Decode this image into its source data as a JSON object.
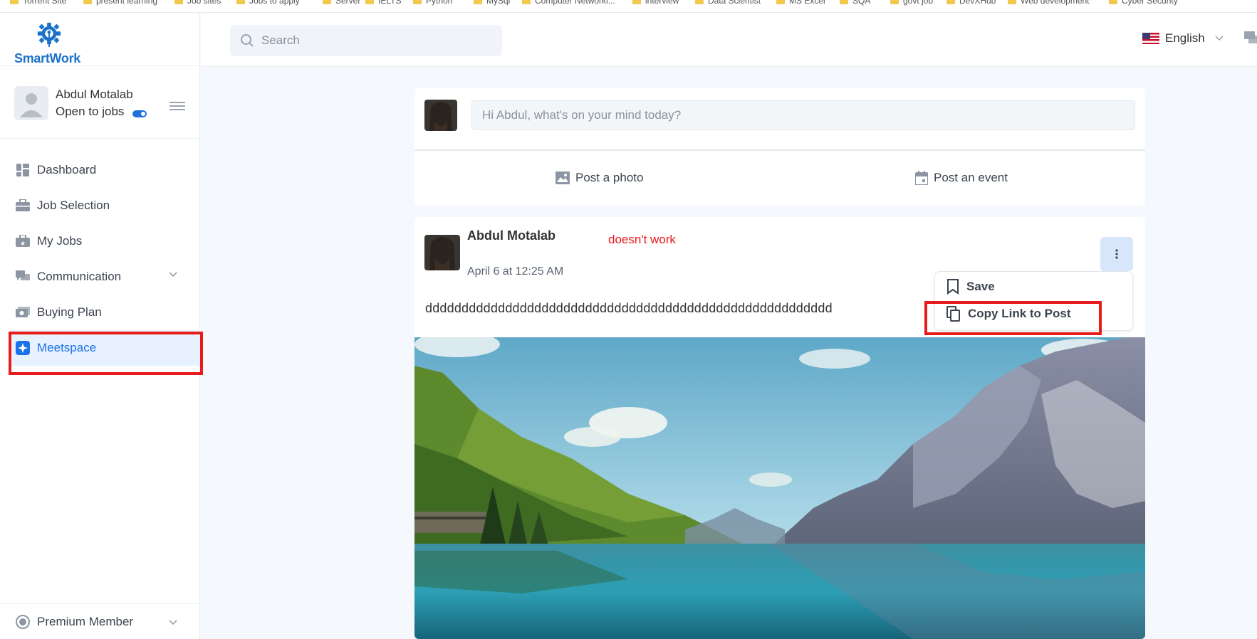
{
  "bookmarks": [
    "Torrent Site",
    "present learning",
    "Job sites",
    "Jobs to apply",
    "Server",
    "IELTS",
    "Python",
    "MySql",
    "Computer Networki...",
    "interview",
    "Data Scientist",
    "MS Excel",
    "SQA",
    "govt job",
    "DevXHub",
    "Web development",
    "Cyber Security"
  ],
  "brand": {
    "name": "SmartWork",
    "accent": "#1a73c9"
  },
  "profile": {
    "name": "Abdul Motalab",
    "status": "Open to jobs"
  },
  "nav": [
    {
      "label": "Dashboard",
      "icon": "dashboard-icon"
    },
    {
      "label": "Job Selection",
      "icon": "briefcase-icon"
    },
    {
      "label": "My Jobs",
      "icon": "star-briefcase-icon"
    },
    {
      "label": "Communication",
      "icon": "chat-icon"
    },
    {
      "label": "Buying Plan",
      "icon": "money-icon"
    },
    {
      "label": "Meetspace",
      "icon": "sparkle-icon"
    }
  ],
  "bottom_nav": {
    "label": "Premium Member",
    "icon": "badge-icon"
  },
  "header": {
    "search_placeholder": "Search",
    "language": "English"
  },
  "composer": {
    "placeholder": "Hi Abdul, what's on your mind today?",
    "photo_label": "Post a photo",
    "event_label": "Post an event"
  },
  "post": {
    "author": "Abdul Motalab",
    "annotation": "doesn't work",
    "time": "April 6 at 12:25 AM",
    "text": "dddddddddddddddddddddddddddddddddddddddddddddddddddddddd"
  },
  "post_menu": {
    "save": "Save",
    "copy_link": "Copy Link to Post"
  },
  "colors": {
    "active_nav_bg": "#e8f1ff",
    "active_nav_text": "#1a73e8",
    "highlight": "#e81b1b"
  }
}
